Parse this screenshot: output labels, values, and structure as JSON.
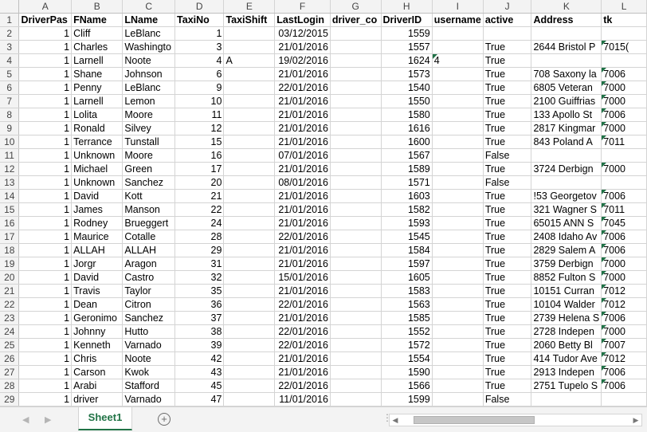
{
  "columns": [
    "A",
    "B",
    "C",
    "D",
    "E",
    "F",
    "G",
    "H",
    "I",
    "J",
    "K",
    "L"
  ],
  "header_row": [
    "DriverPas",
    "FName",
    "LName",
    "TaxiNo",
    "TaxiShift",
    "LastLogin",
    "driver_co",
    "DriverID",
    "username",
    "active",
    "Address",
    "tk"
  ],
  "rows": [
    [
      "1",
      "Cliff",
      "LeBlanc",
      "1",
      "",
      "03/12/2015",
      "",
      "1559",
      "",
      "",
      "",
      ""
    ],
    [
      "1",
      "Charles",
      "Washingto",
      "3",
      "",
      "21/01/2016",
      "",
      "1557",
      "",
      "True",
      "2644 Bristol P",
      "7015("
    ],
    [
      "1",
      "Larnell",
      "Noote",
      "4",
      "A",
      "19/02/2016",
      "",
      "1624",
      "4",
      "True",
      "",
      ""
    ],
    [
      "1",
      "Shane",
      "Johnson",
      "6",
      "",
      "21/01/2016",
      "",
      "1573",
      "",
      "True",
      "708 Saxony la",
      "7006"
    ],
    [
      "1",
      "Penny",
      "LeBlanc",
      "9",
      "",
      "22/01/2016",
      "",
      "1540",
      "",
      "True",
      "6805 Veteran",
      "7000"
    ],
    [
      "1",
      "Larnell",
      "Lemon",
      "10",
      "",
      "21/01/2016",
      "",
      "1550",
      "",
      "True",
      "2100 Guiffrias",
      "7000"
    ],
    [
      "1",
      "Lolita",
      "Moore",
      "11",
      "",
      "21/01/2016",
      "",
      "1580",
      "",
      "True",
      "133 Apollo St",
      "7006"
    ],
    [
      "1",
      "Ronald",
      "Silvey",
      "12",
      "",
      "21/01/2016",
      "",
      "1616",
      "",
      "True",
      "2817 Kingmar",
      "7000"
    ],
    [
      "1",
      "Terrance",
      "Tunstall",
      "15",
      "",
      "21/01/2016",
      "",
      "1600",
      "",
      "True",
      "843 Poland A",
      "7011"
    ],
    [
      "1",
      "Unknown",
      "Moore",
      "16",
      "",
      "07/01/2016",
      "",
      "1567",
      "",
      "False",
      "",
      ""
    ],
    [
      "1",
      "Michael",
      "Green",
      "17",
      "",
      "21/01/2016",
      "",
      "1589",
      "",
      "True",
      "3724 Derbign",
      "7000"
    ],
    [
      "1",
      "Unknown",
      "Sanchez",
      "20",
      "",
      "08/01/2016",
      "",
      "1571",
      "",
      "False",
      "",
      ""
    ],
    [
      "1",
      "David",
      "Kott",
      "21",
      "",
      "21/01/2016",
      "",
      "1603",
      "",
      "True",
      "!53 Georgetov",
      "7006"
    ],
    [
      "1",
      "James",
      "Manson",
      "22",
      "",
      "21/01/2016",
      "",
      "1582",
      "",
      "True",
      "321 Wagner S",
      "7011"
    ],
    [
      "1",
      "Rodney",
      "Brueggert",
      "24",
      "",
      "21/01/2016",
      "",
      "1593",
      "",
      "True",
      "65015 ANN S",
      "7045"
    ],
    [
      "1",
      "Maurice",
      "Cotalle",
      "28",
      "",
      "22/01/2016",
      "",
      "1545",
      "",
      "True",
      "2408 Idaho Av",
      "7006"
    ],
    [
      "1",
      "ALLAH",
      "ALLAH",
      "29",
      "",
      "21/01/2016",
      "",
      "1584",
      "",
      "True",
      "2829 Salem A",
      "7006"
    ],
    [
      "1",
      "Jorgr",
      "Aragon",
      "31",
      "",
      "21/01/2016",
      "",
      "1597",
      "",
      "True",
      "3759 Derbign",
      "7000"
    ],
    [
      "1",
      "David",
      "Castro",
      "32",
      "",
      "15/01/2016",
      "",
      "1605",
      "",
      "True",
      "8852 Fulton S",
      "7000"
    ],
    [
      "1",
      "Travis",
      "Taylor",
      "35",
      "",
      "21/01/2016",
      "",
      "1583",
      "",
      "True",
      "10151 Curran",
      "7012"
    ],
    [
      "1",
      "Dean",
      "Citron",
      "36",
      "",
      "22/01/2016",
      "",
      "1563",
      "",
      "True",
      "10104 Walder",
      "7012"
    ],
    [
      "1",
      "Geronimo",
      "Sanchez",
      "37",
      "",
      "21/01/2016",
      "",
      "1585",
      "",
      "True",
      "2739 Helena S",
      "7006"
    ],
    [
      "1",
      "Johnny",
      "Hutto",
      "38",
      "",
      "22/01/2016",
      "",
      "1552",
      "",
      "True",
      "2728 Indepen",
      "7000"
    ],
    [
      "1",
      "Kenneth",
      "Varnado",
      "39",
      "",
      "22/01/2016",
      "",
      "1572",
      "",
      "True",
      "2060 Betty Bl",
      "7007"
    ],
    [
      "1",
      "Chris",
      "Noote",
      "42",
      "",
      "21/01/2016",
      "",
      "1554",
      "",
      "True",
      "414 Tudor Ave",
      "7012"
    ],
    [
      "1",
      "Carson",
      "Kwok",
      "43",
      "",
      "21/01/2016",
      "",
      "1590",
      "",
      "True",
      "2913 Indepen",
      "7006"
    ],
    [
      "1",
      "Arabi",
      "Stafford",
      "45",
      "",
      "22/01/2016",
      "",
      "1566",
      "",
      "True",
      "2751 Tupelo S",
      "7006"
    ],
    [
      "1",
      "driver",
      "Varnado",
      "47",
      "",
      "11/01/2016",
      "",
      "1599",
      "",
      "False",
      "",
      ""
    ]
  ],
  "flagged_l_rows": [
    1,
    3,
    4,
    5,
    6,
    7,
    8,
    10,
    12,
    13,
    14,
    15,
    16,
    17,
    18,
    19,
    20,
    21,
    22,
    23,
    24,
    25,
    26
  ],
  "sheet_tab": "Sheet1",
  "add_sheet_symbol": "+",
  "colors": {
    "accent": "#217346",
    "grid": "#d4d4d4",
    "header_bg": "#f3f3f3"
  }
}
